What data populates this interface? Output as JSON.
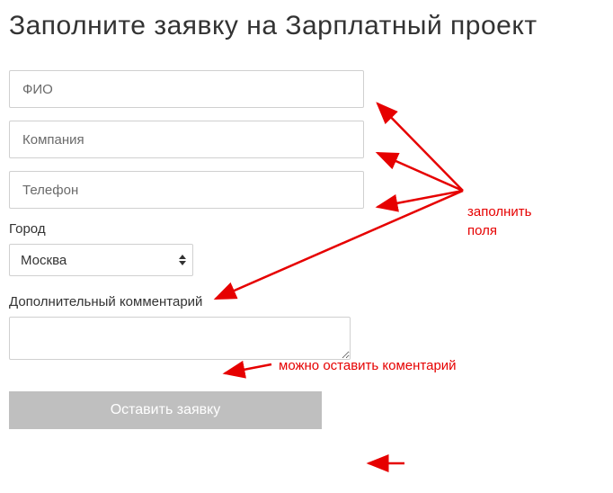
{
  "title": "Заполните заявку на Зарплатный проект",
  "form": {
    "fio_placeholder": "ФИО",
    "company_placeholder": "Компания",
    "phone_placeholder": "Телефон",
    "city_label": "Город",
    "city_value": "Москва",
    "comment_label": "Дополнительный комментарий",
    "submit_label": "Оставить заявку"
  },
  "annotations": {
    "fill_fields": "заполнить\nполя",
    "fill_fields_line1": "заполнить",
    "fill_fields_line2": "поля",
    "comment": "можно оставить коментарий"
  },
  "colors": {
    "annotation_red": "#e60000",
    "button_gray": "#bfbfbf"
  }
}
